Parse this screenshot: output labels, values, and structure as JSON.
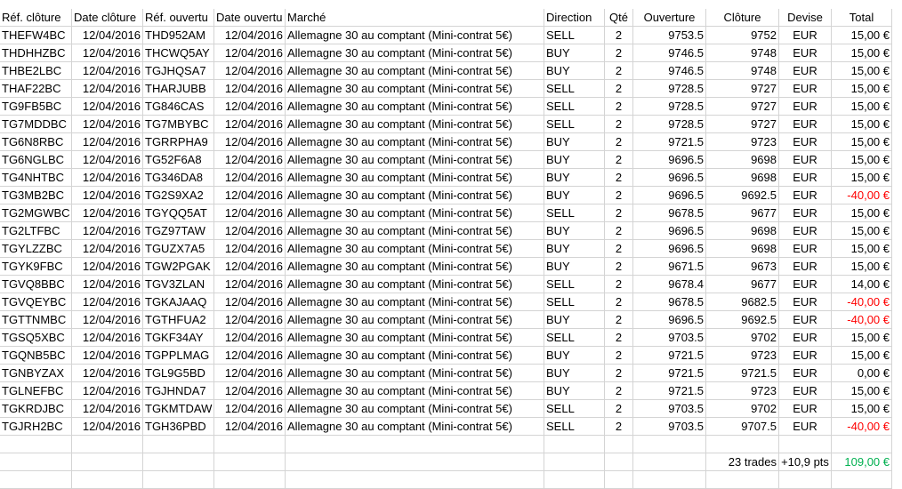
{
  "headers": [
    "Réf. clôture",
    "Date clôture",
    "Réf. ouvertu",
    "Date ouvertu",
    "Marché",
    "Direction",
    "Qté",
    "Ouverture",
    "Clôture",
    "Devise",
    "Total"
  ],
  "trades": [
    [
      "THEFW4BC",
      "12/04/2016",
      "THD952AM",
      "12/04/2016",
      "Allemagne 30 au comptant (Mini-contrat 5€)",
      "SELL",
      "2",
      "9753.5",
      "9752",
      "EUR",
      "15,00 €"
    ],
    [
      "THDHHZBC",
      "12/04/2016",
      "THCWQ5AY",
      "12/04/2016",
      "Allemagne 30 au comptant (Mini-contrat 5€)",
      "BUY",
      "2",
      "9746.5",
      "9748",
      "EUR",
      "15,00 €"
    ],
    [
      "THBE2LBC",
      "12/04/2016",
      "TGJHQSA7",
      "12/04/2016",
      "Allemagne 30 au comptant (Mini-contrat 5€)",
      "BUY",
      "2",
      "9746.5",
      "9748",
      "EUR",
      "15,00 €"
    ],
    [
      "THAF22BC",
      "12/04/2016",
      "THARJUBB",
      "12/04/2016",
      "Allemagne 30 au comptant (Mini-contrat 5€)",
      "SELL",
      "2",
      "9728.5",
      "9727",
      "EUR",
      "15,00 €"
    ],
    [
      "TG9FB5BC",
      "12/04/2016",
      "TG846CAS",
      "12/04/2016",
      "Allemagne 30 au comptant (Mini-contrat 5€)",
      "SELL",
      "2",
      "9728.5",
      "9727",
      "EUR",
      "15,00 €"
    ],
    [
      "TG7MDDBC",
      "12/04/2016",
      "TG7MBYBC",
      "12/04/2016",
      "Allemagne 30 au comptant (Mini-contrat 5€)",
      "SELL",
      "2",
      "9728.5",
      "9727",
      "EUR",
      "15,00 €"
    ],
    [
      "TG6N8RBC",
      "12/04/2016",
      "TGRRPHA9",
      "12/04/2016",
      "Allemagne 30 au comptant (Mini-contrat 5€)",
      "BUY",
      "2",
      "9721.5",
      "9723",
      "EUR",
      "15,00 €"
    ],
    [
      "TG6NGLBC",
      "12/04/2016",
      "TG52F6A8",
      "12/04/2016",
      "Allemagne 30 au comptant (Mini-contrat 5€)",
      "BUY",
      "2",
      "9696.5",
      "9698",
      "EUR",
      "15,00 €"
    ],
    [
      "TG4NHTBC",
      "12/04/2016",
      "TG346DA8",
      "12/04/2016",
      "Allemagne 30 au comptant (Mini-contrat 5€)",
      "BUY",
      "2",
      "9696.5",
      "9698",
      "EUR",
      "15,00 €"
    ],
    [
      "TG3MB2BC",
      "12/04/2016",
      "TG2S9XA2",
      "12/04/2016",
      "Allemagne 30 au comptant (Mini-contrat 5€)",
      "BUY",
      "2",
      "9696.5",
      "9692.5",
      "EUR",
      "-40,00 €"
    ],
    [
      "TG2MGWBC",
      "12/04/2016",
      "TGYQQ5AT",
      "12/04/2016",
      "Allemagne 30 au comptant (Mini-contrat 5€)",
      "SELL",
      "2",
      "9678.5",
      "9677",
      "EUR",
      "15,00 €"
    ],
    [
      "TG2LTFBC",
      "12/04/2016",
      "TGZ97TAW",
      "12/04/2016",
      "Allemagne 30 au comptant (Mini-contrat 5€)",
      "BUY",
      "2",
      "9696.5",
      "9698",
      "EUR",
      "15,00 €"
    ],
    [
      "TGYLZZBC",
      "12/04/2016",
      "TGUZX7A5",
      "12/04/2016",
      "Allemagne 30 au comptant (Mini-contrat 5€)",
      "BUY",
      "2",
      "9696.5",
      "9698",
      "EUR",
      "15,00 €"
    ],
    [
      "TGYK9FBC",
      "12/04/2016",
      "TGW2PGAK",
      "12/04/2016",
      "Allemagne 30 au comptant (Mini-contrat 5€)",
      "BUY",
      "2",
      "9671.5",
      "9673",
      "EUR",
      "15,00 €"
    ],
    [
      "TGVQ8BBC",
      "12/04/2016",
      "TGV3ZLAN",
      "12/04/2016",
      "Allemagne 30 au comptant (Mini-contrat 5€)",
      "SELL",
      "2",
      "9678.4",
      "9677",
      "EUR",
      "14,00 €"
    ],
    [
      "TGVQEYBC",
      "12/04/2016",
      "TGKAJAAQ",
      "12/04/2016",
      "Allemagne 30 au comptant (Mini-contrat 5€)",
      "SELL",
      "2",
      "9678.5",
      "9682.5",
      "EUR",
      "-40,00 €"
    ],
    [
      "TGTTNMBC",
      "12/04/2016",
      "TGTHFUA2",
      "12/04/2016",
      "Allemagne 30 au comptant (Mini-contrat 5€)",
      "BUY",
      "2",
      "9696.5",
      "9692.5",
      "EUR",
      "-40,00 €"
    ],
    [
      "TGSQ5XBC",
      "12/04/2016",
      "TGKF34AY",
      "12/04/2016",
      "Allemagne 30 au comptant (Mini-contrat 5€)",
      "SELL",
      "2",
      "9703.5",
      "9702",
      "EUR",
      "15,00 €"
    ],
    [
      "TGQNB5BC",
      "12/04/2016",
      "TGPPLMAG",
      "12/04/2016",
      "Allemagne 30 au comptant (Mini-contrat 5€)",
      "BUY",
      "2",
      "9721.5",
      "9723",
      "EUR",
      "15,00 €"
    ],
    [
      "TGNBYZAX",
      "12/04/2016",
      "TGL9G5BD",
      "12/04/2016",
      "Allemagne 30 au comptant (Mini-contrat 5€)",
      "BUY",
      "2",
      "9721.5",
      "9721.5",
      "EUR",
      "0,00 €"
    ],
    [
      "TGLNEFBC",
      "12/04/2016",
      "TGJHNDA7",
      "12/04/2016",
      "Allemagne 30 au comptant (Mini-contrat 5€)",
      "BUY",
      "2",
      "9721.5",
      "9723",
      "EUR",
      "15,00 €"
    ],
    [
      "TGKRDJBC",
      "12/04/2016",
      "TGKMTDAW",
      "12/04/2016",
      "Allemagne 30 au comptant (Mini-contrat 5€)",
      "SELL",
      "2",
      "9703.5",
      "9702",
      "EUR",
      "15,00 €"
    ],
    [
      "TGJRH2BC",
      "12/04/2016",
      "TGH36PBD",
      "12/04/2016",
      "Allemagne 30 au comptant (Mini-contrat 5€)",
      "SELL",
      "2",
      "9703.5",
      "9707.5",
      "EUR",
      "-40,00 €"
    ]
  ],
  "summary": {
    "trades_count": "23 trades",
    "points": "+10,9 pts",
    "total": "109,00 €"
  },
  "colors": {
    "negative": "#ff0000",
    "positive_total": "#00b050",
    "gridline": "#d4d4d4"
  }
}
